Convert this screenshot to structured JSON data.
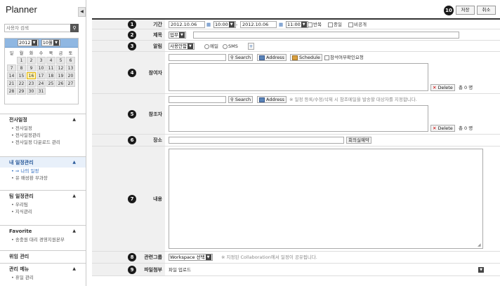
{
  "app": {
    "title": "Planner"
  },
  "sidebar": {
    "search_placeholder": "사용자 검색",
    "calendar": {
      "year": "2012",
      "month": "10월",
      "weekdays": [
        "일",
        "월",
        "화",
        "수",
        "목",
        "금",
        "토"
      ],
      "weeks": [
        [
          "",
          "1",
          "2",
          "3",
          "4",
          "5",
          "6"
        ],
        [
          "7",
          "8",
          "9",
          "10",
          "11",
          "12",
          "13"
        ],
        [
          "14",
          "15",
          "16",
          "17",
          "18",
          "19",
          "20"
        ],
        [
          "21",
          "22",
          "23",
          "24",
          "25",
          "26",
          "27"
        ],
        [
          "28",
          "29",
          "30",
          "31",
          "",
          "",
          ""
        ]
      ],
      "today": "16"
    },
    "sections": [
      {
        "title": "전사일정",
        "arrow": "▲",
        "items": [
          "• 전사일정",
          "• 전사일정관리",
          "• 전사일정 다운로드 관리"
        ]
      },
      {
        "title": "내 일정관리",
        "arrow": "▲",
        "items": [
          "• ⇒ 나의 일정",
          "• 유 배성환 부과장"
        ]
      },
      {
        "title": "팀 일정관리",
        "arrow": "▲",
        "items": [
          "• 우리팀",
          "• 지식관리"
        ]
      },
      {
        "title": "Favorite",
        "arrow": "▲",
        "items": [
          "• 송충원 대리 경영지원본부"
        ]
      },
      {
        "title": "위임 관리",
        "arrow": "",
        "items": []
      },
      {
        "title": "관리 메뉴",
        "arrow": "▲",
        "items": [
          "• 휴일 관리"
        ]
      }
    ]
  },
  "toolbar": {
    "badge": "10",
    "save": "저장",
    "cancel": "취소"
  },
  "form": {
    "period": {
      "badge": "1",
      "label": "기간",
      "start_date": "2012.10.06",
      "start_time": "10:00",
      "sep": "-",
      "end_date": "2012.10.06",
      "end_time": "11:00",
      "repeat": "반복",
      "allday": "종일",
      "private": "비공개"
    },
    "subject": {
      "badge": "2",
      "label": "제목",
      "type": "업무"
    },
    "alarm": {
      "badge": "3",
      "label": "알림",
      "value": "사용안함",
      "email": "메일",
      "sms": "SMS",
      "plus": "+"
    },
    "attendees": {
      "badge": "4",
      "label": "참여자",
      "search": "Search",
      "address": "Address",
      "schedule": "Schedule",
      "confirm": "참석여부확인요청",
      "delete": "Delete",
      "count": "총 0 명"
    },
    "reference": {
      "badge": "5",
      "label": "참조자",
      "search": "Search",
      "address": "Address",
      "note": "※ 일정 등록/수정/삭제 시 참조메일을 발송할 대상자를 지정합니다.",
      "delete": "Delete",
      "count": "총 0 명"
    },
    "place": {
      "badge": "6",
      "label": "장소",
      "room": "회의실예약"
    },
    "content": {
      "badge": "7",
      "label": "내용"
    },
    "group": {
      "badge": "8",
      "label": "관련그룹",
      "value": "Workspace 선택",
      "note": "※ 지정된 Collaboration에서 일정이 공유됩니다."
    },
    "attach": {
      "badge": "9",
      "label": "파일첨부",
      "value": "파일 업로드"
    }
  }
}
